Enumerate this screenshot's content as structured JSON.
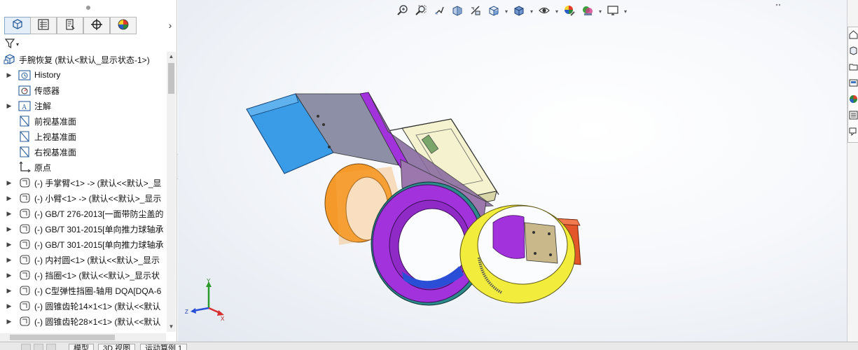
{
  "feature_tree": {
    "tabs": [
      "featuremanager-icon",
      "propertymanager-icon",
      "configurationmanager-icon",
      "dimxpert-icon",
      "displaymanager-icon"
    ],
    "root_label": "手腕恢复 (默认<默认_显示状态-1>)",
    "items": [
      {
        "label": "History",
        "icon": "history-folder-icon",
        "expandable": true
      },
      {
        "label": "传感器",
        "icon": "sensor-icon",
        "expandable": false
      },
      {
        "label": "注解",
        "icon": "annotation-icon",
        "expandable": true
      },
      {
        "label": "前视基准面",
        "icon": "plane-icon",
        "expandable": false
      },
      {
        "label": "上视基准面",
        "icon": "plane-icon",
        "expandable": false
      },
      {
        "label": "右视基准面",
        "icon": "plane-icon",
        "expandable": false
      },
      {
        "label": "原点",
        "icon": "origin-icon",
        "expandable": false
      },
      {
        "label": "(-) 手掌臂<1> -> (默认<<默认>_显",
        "icon": "part-icon",
        "expandable": true
      },
      {
        "label": "(-) 小臂<1> -> (默认<<默认>_显示",
        "icon": "part-icon",
        "expandable": true
      },
      {
        "label": "(-) GB/T 276-2013[一面带防尘盖的",
        "icon": "part-icon",
        "expandable": true
      },
      {
        "label": "(-) GB/T 301-2015[单向推力球轴承",
        "icon": "part-icon",
        "expandable": true
      },
      {
        "label": "(-) GB/T 301-2015[单向推力球轴承",
        "icon": "part-icon",
        "expandable": true
      },
      {
        "label": "(-) 内衬圆<1> (默认<<默认>_显示",
        "icon": "part-icon",
        "expandable": true
      },
      {
        "label": "(-) 挡圈<1> (默认<<默认>_显示状",
        "icon": "part-icon",
        "expandable": true
      },
      {
        "label": "(-) C型弹性挡圈-轴用 DQA[DQA-6",
        "icon": "part-icon",
        "expandable": true
      },
      {
        "label": "(-) 圆锥齿轮14×1<1> (默认<<默认",
        "icon": "part-icon",
        "expandable": true
      },
      {
        "label": "(-) 圆锥齿轮28×1<1> (默认<<默认",
        "icon": "part-icon",
        "expandable": true
      }
    ]
  },
  "bottom_tabs": [
    "模型",
    "3D 视图",
    "运动算例 1"
  ],
  "heads_up_toolbar": [
    "zoom-to-fit-icon",
    "zoom-to-area-icon",
    "previous-view-icon",
    "section-view-icon",
    "dynamic-annotation-icon",
    "view-orientation-icon",
    "display-style-icon",
    "hide-show-items-icon",
    "edit-appearance-icon",
    "apply-scene-icon",
    "view-settings-icon"
  ],
  "task_pane": [
    "solidworks-resources-icon",
    "design-library-icon",
    "file-explorer-icon",
    "view-palette-icon",
    "appearances-icon",
    "custom-properties-icon",
    "forum-icon"
  ],
  "triad": {
    "x": "X",
    "y": "Y",
    "z": "Z"
  },
  "colors": {
    "blue_part": "#3a9be6",
    "purple_part": "#9a2fd6",
    "orange_part": "#f59a2a",
    "yellow_part": "#f2ec3c",
    "red_part": "#e2562a",
    "housing": "#f4f2c8"
  }
}
